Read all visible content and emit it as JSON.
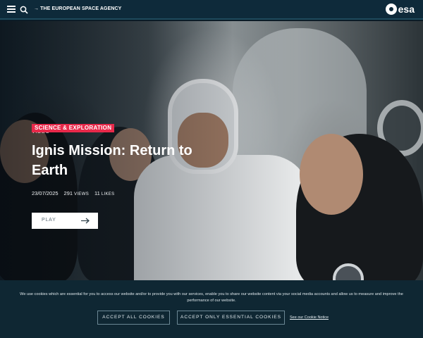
{
  "header": {
    "agency_name": "→ THE EUROPEAN SPACE AGENCY",
    "logo_text": "esa",
    "menu_icon": "hamburger-icon",
    "search_icon": "search-icon",
    "colors": {
      "bar": "#0e2a3a",
      "accent": "#e8294a"
    }
  },
  "hero": {
    "media_type": "VIDEO",
    "category": "SCIENCE & EXPLORATION",
    "title": "Ignis Mission: Return to Earth",
    "date": "23/07/2025",
    "views_count": "291",
    "views_label": "VIEWS",
    "likes_count": "11",
    "likes_label": "LIKES",
    "play_label": "PLAY",
    "play_icon": "arrow-right-icon"
  },
  "cookie_banner": {
    "text": "We use cookies which are essential for you to access our website and/or to provide you with our services, enable you to share our website content via your social media accounts and allow us to measure and improve the performance of our website.",
    "accept_all_label": "ACCEPT ALL COOKIES",
    "accept_essential_label": "ACCEPT ONLY ESSENTIAL COOKIES",
    "notice_link_label": "See our Cookie Notice"
  }
}
